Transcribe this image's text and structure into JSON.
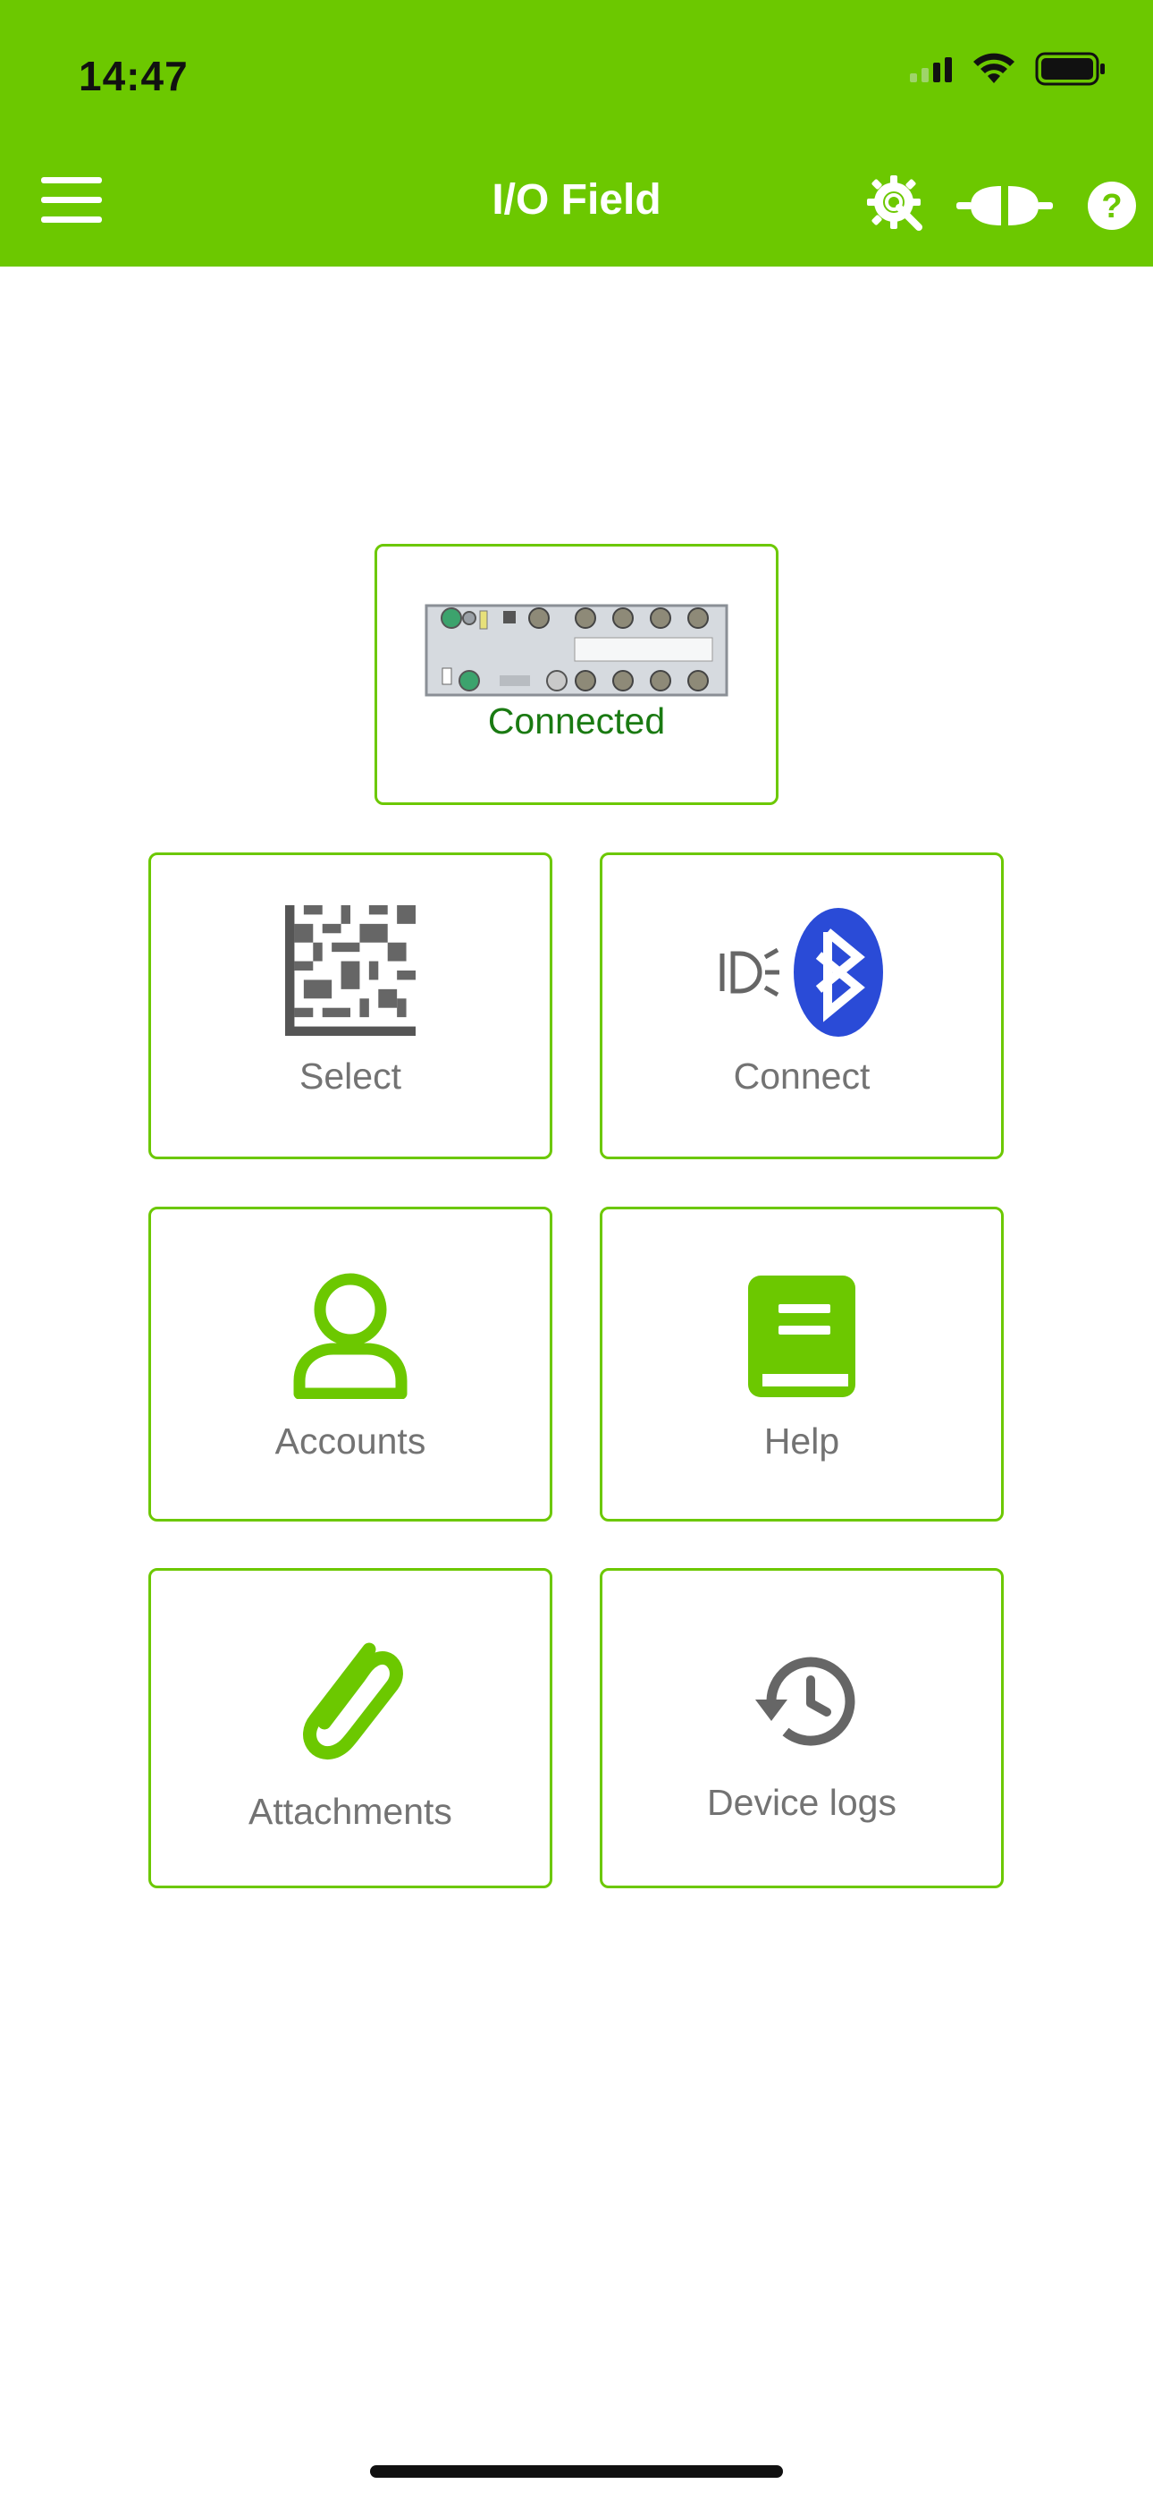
{
  "status_bar": {
    "time": "14:47"
  },
  "header": {
    "title": "I/O Field"
  },
  "device": {
    "status": "Connected"
  },
  "tiles": [
    {
      "label": "Select",
      "icon": "datamatrix-icon"
    },
    {
      "label": "Connect",
      "icon": "bluetooth-icon"
    },
    {
      "label": "Accounts",
      "icon": "user-icon"
    },
    {
      "label": "Help",
      "icon": "book-icon"
    },
    {
      "label": "Attachments",
      "icon": "paperclip-icon"
    },
    {
      "label": "Device logs",
      "icon": "history-icon"
    }
  ],
  "colors": {
    "brand": "#6cc800",
    "tile_text": "#737373",
    "connected_text": "#1a7a12",
    "bluetooth": "#2a4bd7"
  }
}
